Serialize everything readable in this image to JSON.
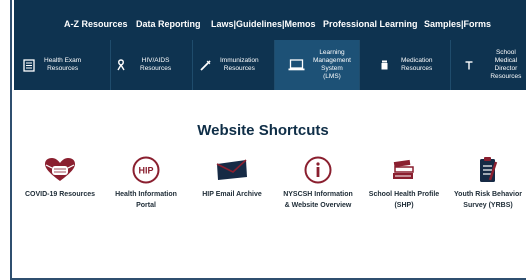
{
  "top_nav": {
    "items": [
      "A-Z Resources",
      "Data Reporting",
      "Laws|Guidelines|Memos",
      "Professional Learning",
      "Samples|Forms"
    ]
  },
  "icon_bar": {
    "items": [
      {
        "label": "Health Exam\nResources",
        "icon": "document-list-icon"
      },
      {
        "label": "HIV/AIDS\nResources",
        "icon": "ribbon-icon"
      },
      {
        "label": "Immunization\nResources",
        "icon": "syringe-icon"
      },
      {
        "label": "Learning\nManagement\nSystem\n(LMS)",
        "icon": "laptop-icon"
      },
      {
        "label": "Medication\nResources",
        "icon": "pill-bottle-icon"
      },
      {
        "label": "School Medical\nDirector\nResources",
        "icon": "stethoscope-icon"
      }
    ]
  },
  "shortcuts": {
    "title": "Website Shortcuts",
    "items": [
      {
        "label": "COVID-19 Resources",
        "icon": "heart-mask-icon"
      },
      {
        "label": "Health Information\nPortal",
        "icon": "hip-badge-icon",
        "badge": "HIP"
      },
      {
        "label": "HIP Email Archive",
        "icon": "envelope-icon"
      },
      {
        "label": "NYSCSH Information\n& Website Overview",
        "icon": "info-icon"
      },
      {
        "label": "School Health Profile\n(SHP)",
        "icon": "books-icon"
      },
      {
        "label": "Youth Risk Behavior\nSurvey (YRBS)",
        "icon": "clipboard-icon"
      }
    ]
  },
  "colors": {
    "nav_bg": "#0e3350",
    "accent": "#8a1f2f",
    "text_dark": "#0f2e47"
  }
}
